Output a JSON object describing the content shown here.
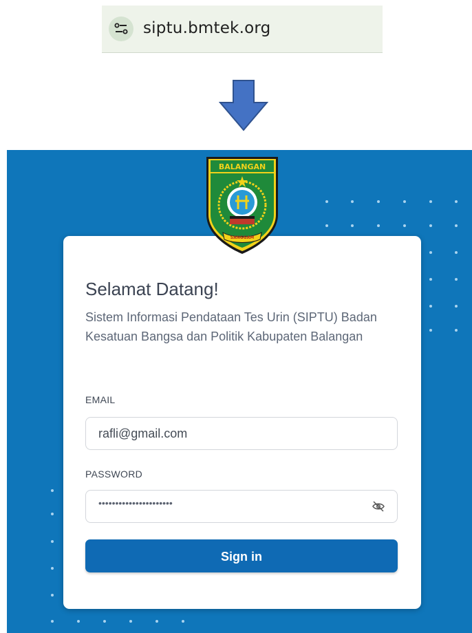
{
  "browser": {
    "url": "siptu.bmtek.org",
    "site_icon": "tune-icon"
  },
  "annotation": {
    "arrow_icon": "down-arrow-icon",
    "arrow_color": "#4472c4"
  },
  "background": {
    "color": "#0f76ba"
  },
  "logo": {
    "banner_text": "BALANGAN",
    "ribbon_text": "SANGGAM"
  },
  "login": {
    "title": "Selamat Datang!",
    "subtitle": "Sistem Informasi Pendataan Tes Urin (SIPTU) Badan Kesatuan Bangsa dan Politik Kabupaten Balangan",
    "email_label": "EMAIL",
    "email_value": "rafli@gmail.com",
    "password_label": "PASSWORD",
    "password_value": "••••••••••••••••••••••",
    "visibility_icon": "eye-off-icon",
    "signin_label": "Sign in",
    "accent_color": "#0f6ab4"
  }
}
